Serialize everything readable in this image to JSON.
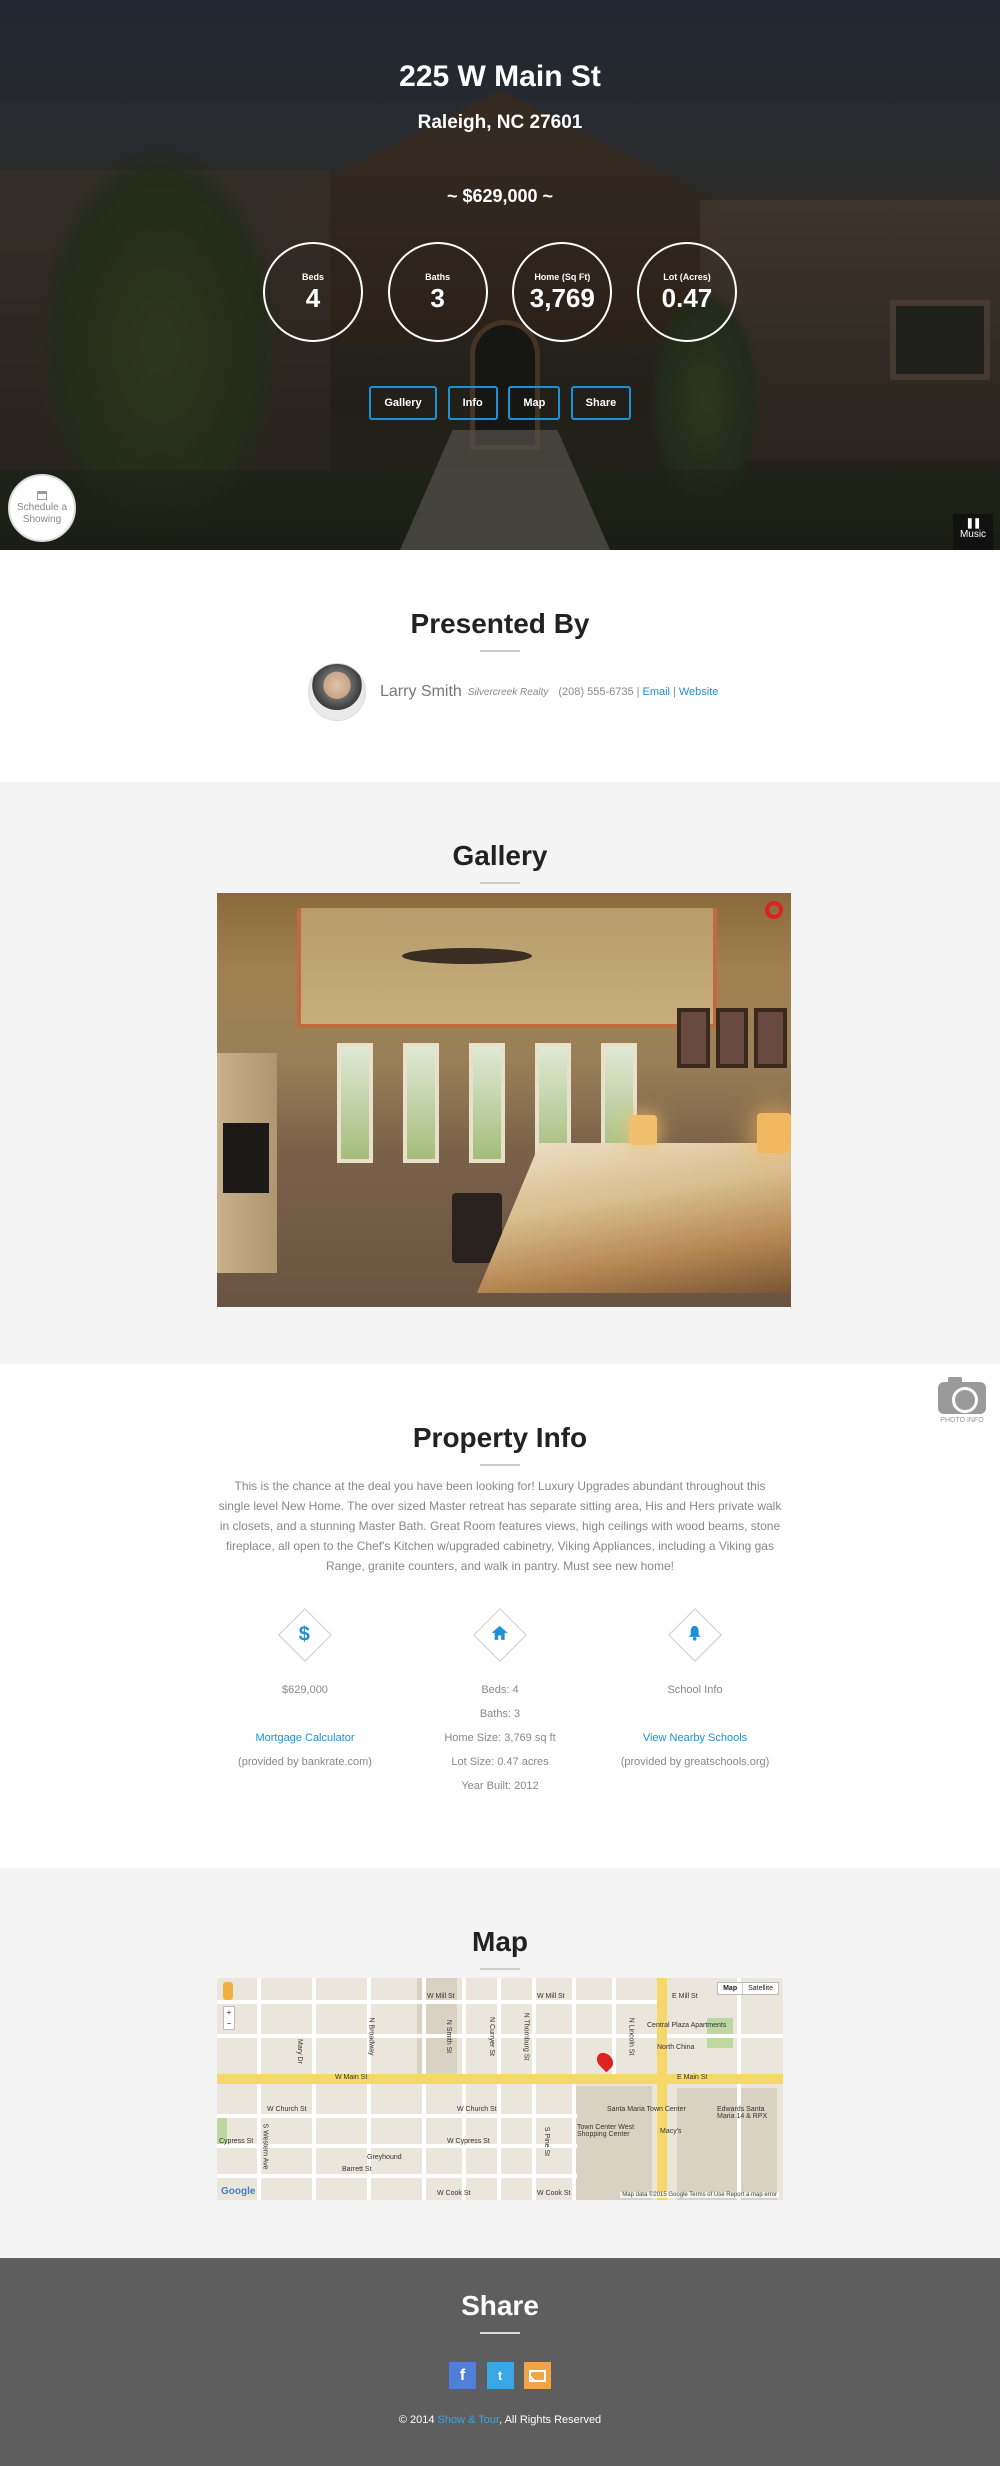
{
  "hero": {
    "address": "225 W Main St",
    "city": "Raleigh, NC 27601",
    "price": "~ $629,000 ~",
    "stats": [
      {
        "label": "Beds",
        "value": "4"
      },
      {
        "label": "Baths",
        "value": "3"
      },
      {
        "label": "Home (Sq Ft)",
        "value": "3,769"
      },
      {
        "label": "Lot (Acres)",
        "value": "0.47"
      }
    ],
    "nav": [
      "Gallery",
      "Info",
      "Map",
      "Share"
    ],
    "schedule_line1": "Schedule a",
    "schedule_line2": "Showing",
    "music_label": "Music",
    "music_icon": "❚❚"
  },
  "presented": {
    "title": "Presented By",
    "name": "Larry Smith",
    "company": "Silvercreek Realty",
    "phone": "(208) 555-6735",
    "sep": "|",
    "email": "Email",
    "website": "Website"
  },
  "gallery": {
    "title": "Gallery"
  },
  "photo_info": {
    "label": "PHOTO INFO"
  },
  "property_info": {
    "title": "Property Info",
    "description": "This is the chance at the deal you have been looking for! Luxury Upgrades abundant throughout this single level New Home. The over sized Master retreat has separate sitting area, His and Hers private walk in closets, and a stunning Master Bath. Great Room features views, high ceilings with wood beams, stone fireplace, all open to the Chef's Kitchen w/upgraded cabinetry, Viking Appliances, including a Viking gas Range, granite counters, and walk in pantry. Must see new home!",
    "price_col": {
      "icon": "$",
      "value": "$629,000",
      "link": "Mortgage Calculator",
      "note": "(provided by bankrate.com)"
    },
    "home_col": {
      "beds": "Beds: 4",
      "baths": "Baths: 3",
      "size": "Home Size: 3,769 sq ft",
      "lot": "Lot Size: 0.47 acres",
      "year": "Year Built: 2012"
    },
    "school_col": {
      "value": "School Info",
      "link": "View Nearby Schools",
      "note": "(provided by greatschools.org)"
    }
  },
  "map": {
    "title": "Map",
    "type_map": "Map",
    "type_satellite": "Satellite",
    "zoom_in": "+",
    "zoom_out": "−",
    "logo": "Google",
    "terms": "Map data ©2015 Google   Terms of Use   Report a map error",
    "streets": {
      "w_mill": "W Mill St",
      "w_mill2": "W Mill St",
      "e_mill": "E Mill St",
      "w_main": "W Main St",
      "e_main": "E Main St",
      "w_church": "W Church St",
      "w_church2": "W Church St",
      "w_cypress": "W Cypress St",
      "cypress": "Cypress St",
      "barrett": "Barrett St",
      "w_cook": "W Cook St",
      "w_cook2": "W Cook St",
      "central_plaza": "Central Plaza Apartments",
      "north_china": "North China",
      "santa_maria": "Santa Maria Town Center",
      "town_center": "Town Center West Shopping Center",
      "macys": "Macy's",
      "edwards": "Edwards Santa Maria 14 & RPX",
      "greyhound": "Greyhound",
      "mary_dr": "Mary Dr",
      "n_broadway": "N Broadway",
      "n_smith": "N Smith St",
      "n_curryer": "N Curryer St",
      "n_thornburg": "N Thornburg St",
      "n_lincoln": "N Lincoln St",
      "s_western": "S Western Ave",
      "s_pine": "S Pine St"
    }
  },
  "share": {
    "title": "Share",
    "facebook_icon": "f",
    "twitter_icon": "t",
    "copyright_prefix": "© 2014 ",
    "brand": "Show & Tour",
    "copyright_suffix": ", All Rights Reserved"
  },
  "colors": {
    "accent": "#1e90d6",
    "footer_bg": "#5e5e5e",
    "section_alt": "#f4f4f4"
  }
}
